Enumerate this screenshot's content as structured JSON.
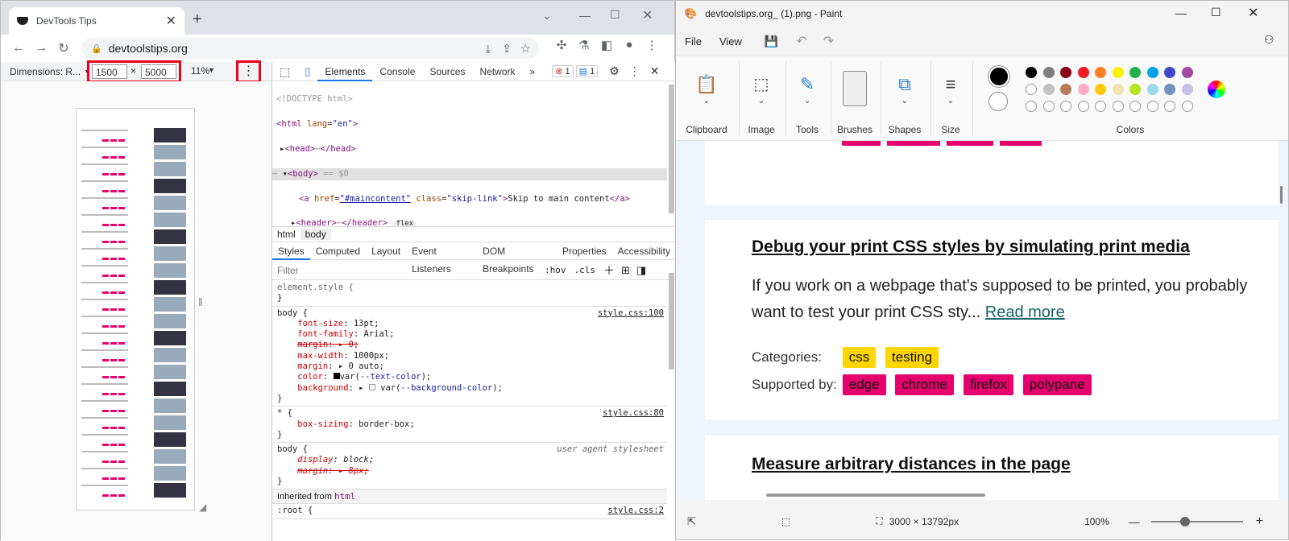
{
  "browser": {
    "tab_title": "DevTools Tips",
    "url": "devtoolstips.org",
    "device_toolbar": {
      "dimensions_label": "Dimensions: R...",
      "width": "1500",
      "height": "5000",
      "times": "×",
      "zoom": "11%"
    }
  },
  "devtools": {
    "tabs": [
      "Elements",
      "Console",
      "Sources",
      "Network"
    ],
    "more_tabs": "»",
    "errors": "1",
    "messages": "1",
    "breadcrumbs": [
      "html",
      "body"
    ],
    "style_tabs": [
      "Styles",
      "Computed",
      "Layout",
      "Event Listeners",
      "DOM Breakpoints",
      "Properties",
      "Accessibility"
    ],
    "filter_placeholder": "Filter",
    "hov": ":hov",
    "cls": ".cls",
    "inherited_from": "Inherited from",
    "inherited_tag": "html",
    "body_eq": "== $0",
    "flex_badge": "flex",
    "sources": {
      "body": "style.css:100",
      "star": "style.css:80",
      "ua": "user agent stylesheet",
      "root": "style.css:2"
    }
  },
  "paint": {
    "title": "devtoolstips.org_ (1).png - Paint",
    "menu": [
      "File",
      "View"
    ],
    "groups": [
      "Clipboard",
      "Image",
      "Tools",
      "Brushes",
      "Shapes",
      "Size",
      "Colors"
    ],
    "palette": [
      "#000000",
      "#7f7f7f",
      "#880015",
      "#ed1c24",
      "#ff7f27",
      "#fff200",
      "#22b14c",
      "#00a2e8",
      "#3f48cc",
      "#a349a4",
      "#ffffff",
      "#c3c3c3",
      "#b97a57",
      "#ffaec9",
      "#ffc90e",
      "#efe4b0",
      "#b5e61d",
      "#99d9ea",
      "#7092be",
      "#c8bfe7"
    ],
    "article1": {
      "title": "Debug your print CSS styles by simulating print media",
      "text": "If you work on a webpage that's supposed to be printed, you probably want to test your print CSS sty...",
      "read_more": "Read more",
      "categories_label": "Categories:",
      "categories": [
        "css",
        "testing"
      ],
      "supported_label": "Supported by:",
      "supported": [
        "edge",
        "chrome",
        "firefox",
        "polypane"
      ]
    },
    "article2": {
      "title": "Measure arbitrary distances in the page"
    },
    "status": {
      "size": "3000 × 13792px",
      "zoom": "100%"
    }
  }
}
